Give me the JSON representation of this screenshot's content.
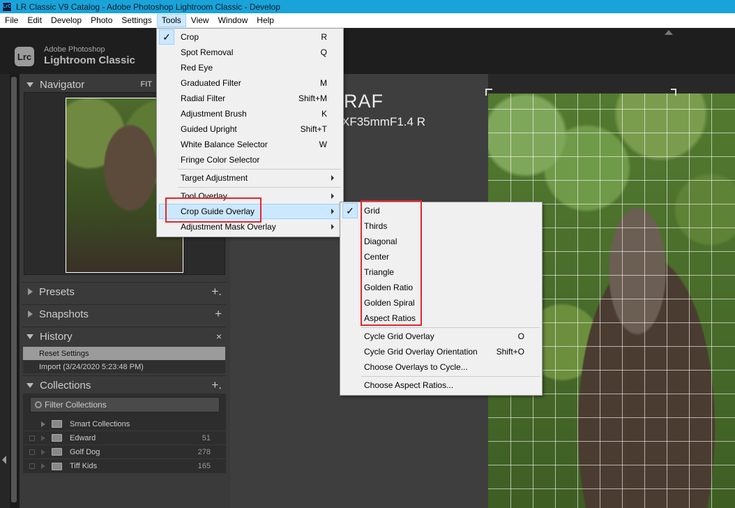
{
  "window": {
    "title": "LR Classic V9 Catalog - Adobe Photoshop Lightroom Classic - Develop",
    "icon_label": "LrC"
  },
  "menubar": [
    "File",
    "Edit",
    "Develop",
    "Photo",
    "Settings",
    "Tools",
    "View",
    "Window",
    "Help"
  ],
  "brand": {
    "logo": "Lrc",
    "line1": "Adobe Photoshop",
    "line2": "Lightroom Classic"
  },
  "left_panel": {
    "navigator": {
      "title": "Navigator",
      "fit": "FIT"
    },
    "presets": {
      "title": "Presets",
      "plus": "+."
    },
    "snapshots": {
      "title": "Snapshots",
      "plus": "+"
    },
    "history": {
      "title": "History",
      "close": "×",
      "items": [
        "Reset Settings",
        "Import (3/24/2020 5:23:48 PM)"
      ]
    },
    "collections": {
      "title": "Collections",
      "plus": "+.",
      "filter_placeholder": "Filter Collections",
      "items": [
        {
          "name": "Smart Collections",
          "count": ""
        },
        {
          "name": "Edward",
          "count": "51"
        },
        {
          "name": "Golf Dog",
          "count": "278"
        },
        {
          "name": "Tiff Kids",
          "count": "165"
        }
      ]
    }
  },
  "overlay_info": {
    "line1": "RAF",
    "line2": "XF35mmF1.4 R"
  },
  "tools_menu": [
    {
      "label": "Crop",
      "shortcut": "R",
      "checked": true
    },
    {
      "label": "Spot Removal",
      "shortcut": "Q"
    },
    {
      "label": "Red Eye",
      "shortcut": ""
    },
    {
      "label": "Graduated Filter",
      "shortcut": "M"
    },
    {
      "label": "Radial Filter",
      "shortcut": "Shift+M"
    },
    {
      "label": "Adjustment Brush",
      "shortcut": "K"
    },
    {
      "label": "Guided Upright",
      "shortcut": "Shift+T"
    },
    {
      "label": "White Balance Selector",
      "shortcut": "W"
    },
    {
      "label": "Fringe Color Selector",
      "shortcut": ""
    },
    {
      "label": "Target Adjustment",
      "submenu": true
    },
    {
      "label": "Tool Overlay",
      "submenu": true
    },
    {
      "label": "Crop Guide Overlay",
      "submenu": true,
      "highlighted": true
    },
    {
      "label": "Adjustment Mask Overlay",
      "submenu": true
    }
  ],
  "crop_guide_submenu": [
    {
      "label": "Grid",
      "shortcut": "",
      "checked": true
    },
    {
      "label": "Thirds",
      "shortcut": ""
    },
    {
      "label": "Diagonal",
      "shortcut": ""
    },
    {
      "label": "Center",
      "shortcut": ""
    },
    {
      "label": "Triangle",
      "shortcut": ""
    },
    {
      "label": "Golden Ratio",
      "shortcut": ""
    },
    {
      "label": "Golden Spiral",
      "shortcut": ""
    },
    {
      "label": "Aspect Ratios",
      "shortcut": ""
    },
    {
      "label": "Cycle Grid Overlay",
      "shortcut": "O"
    },
    {
      "label": "Cycle Grid Overlay Orientation",
      "shortcut": "Shift+O"
    },
    {
      "label": "Choose Overlays to Cycle...",
      "shortcut": ""
    },
    {
      "label": "Choose Aspect Ratios...",
      "shortcut": ""
    }
  ],
  "colors": {
    "titlebar": "#1aa3d9",
    "menu_highlight": "#cce8ff",
    "annotation_red": "#e8242c"
  }
}
